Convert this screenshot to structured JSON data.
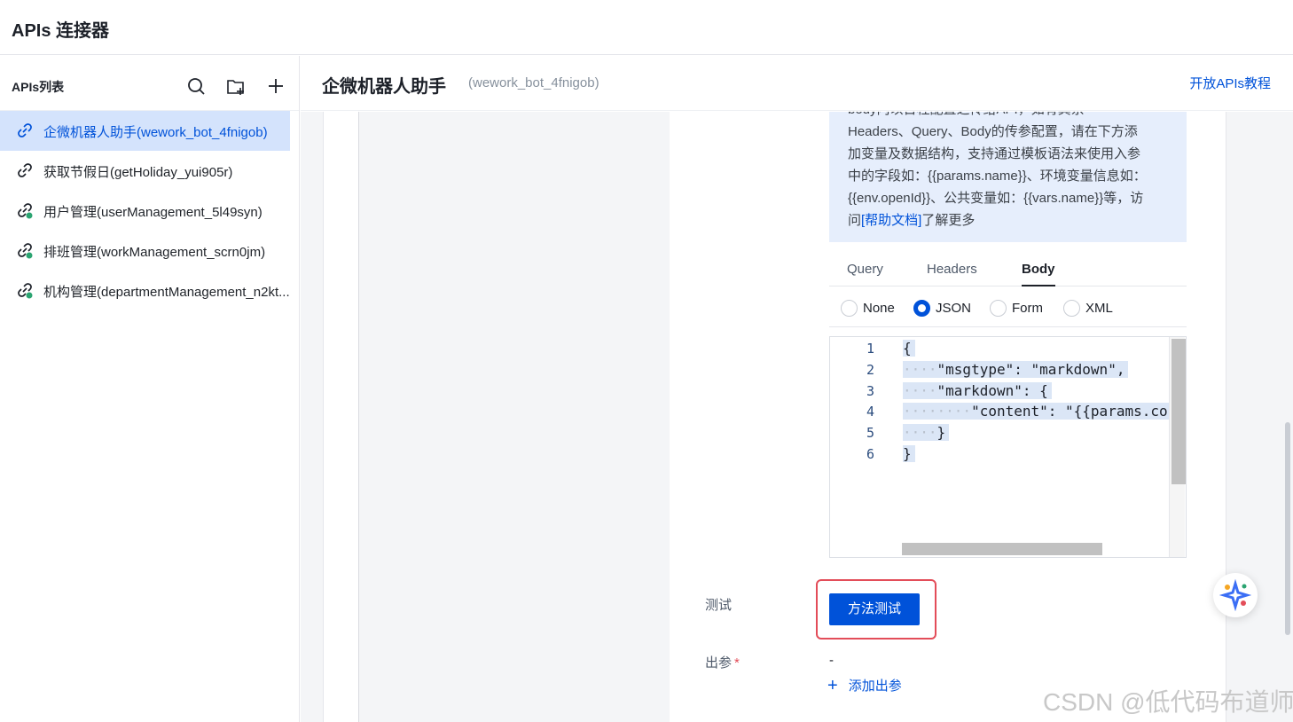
{
  "app": {
    "title": "APIs 连接器"
  },
  "sidebar": {
    "title": "APIs列表",
    "items": [
      {
        "label": "企微机器人助手(wework_bot_4fnigob)",
        "active": true
      },
      {
        "label": "获取节假日(getHoliday_yui905r)",
        "active": false
      },
      {
        "label": "用户管理(userManagement_5l49syn)",
        "active": false
      },
      {
        "label": "排班管理(workManagement_scrn0jm)",
        "active": false
      },
      {
        "label": "机构管理(departmentManagement_n2kt...",
        "active": false
      }
    ]
  },
  "content": {
    "title": "企微机器人助手",
    "subtitle": "(wework_bot_4fnigob)",
    "tutorial_link": "开放APIs教程"
  },
  "info": {
    "line0": "body内以日程配置之传给API，如有其余",
    "line1": "Headers、Query、Body的传参配置，请在下方添",
    "line2": "加变量及数据结构，支持通过模板语法来使用入参",
    "line3": "中的字段如：{{params.name}}、环境变量信息如：",
    "line4": "{{env.openId}}、公共变量如：{{vars.name}}等，访",
    "line5_prefix": "问",
    "line5_link": "[帮助文档]",
    "line5_suffix": "了解更多"
  },
  "tabs": [
    {
      "label": "Query",
      "active": false
    },
    {
      "label": "Headers",
      "active": false
    },
    {
      "label": "Body",
      "active": true
    }
  ],
  "body_types": [
    {
      "label": "None",
      "checked": false
    },
    {
      "label": "JSON",
      "checked": true
    },
    {
      "label": "Form",
      "checked": false
    },
    {
      "label": "XML",
      "checked": false
    }
  ],
  "editor": {
    "line_numbers": [
      "1",
      "2",
      "3",
      "4",
      "5",
      "6"
    ],
    "lines": [
      "{",
      "\"msgtype\": \"markdown\",",
      "\"markdown\": {",
      "\"content\": \"{{params.cont",
      "}",
      "}"
    ]
  },
  "test": {
    "label": "测试",
    "button": "方法测试"
  },
  "output": {
    "label": "出参",
    "required_mark": "*",
    "value": "-",
    "add_label": "添加出参"
  },
  "watermark": "CSDN @低代码布道师",
  "colors": {
    "accent": "#0052d9",
    "highlight_frame": "#e34d59",
    "active_item_bg": "#d4e3fc"
  }
}
